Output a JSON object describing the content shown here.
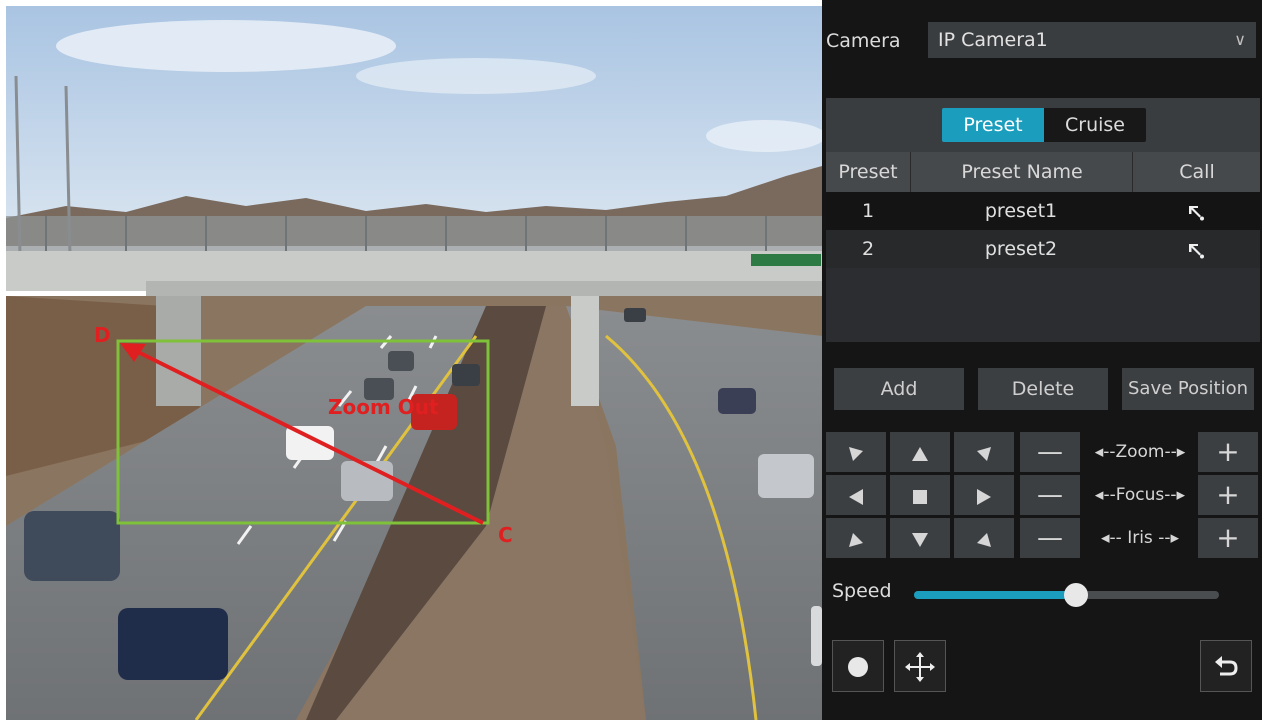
{
  "video": {
    "annotation_label": "Zoom Out",
    "corner_start": "D",
    "corner_end": "C"
  },
  "panel": {
    "camera_label": "Camera",
    "camera_value": "IP Camera1",
    "tabs": {
      "preset": "Preset",
      "cruise": "Cruise"
    },
    "table": {
      "headers": [
        "Preset",
        "Preset Name",
        "Call"
      ],
      "rows": [
        {
          "id": "1",
          "name": "preset1"
        },
        {
          "id": "2",
          "name": "preset2"
        }
      ]
    },
    "buttons": {
      "add": "Add",
      "delete": "Delete",
      "save_position": "Save Position"
    },
    "ptz": {
      "zoom_label": "◂--Zoom--▸",
      "focus_label": "◂--Focus--▸",
      "iris_label": "◂-- Iris --▸"
    },
    "speed": {
      "label": "Speed",
      "value": 0.53
    }
  },
  "icons": {
    "dropdown": "chevron-down-icon",
    "call": "call-preset-icon",
    "record": "record-icon",
    "move": "move-icon",
    "back": "return-icon"
  },
  "colors": {
    "accent": "#1b9ebd",
    "panel_bg": "#151515",
    "annotation_red": "#e02020",
    "box_green": "#7fc23a"
  }
}
